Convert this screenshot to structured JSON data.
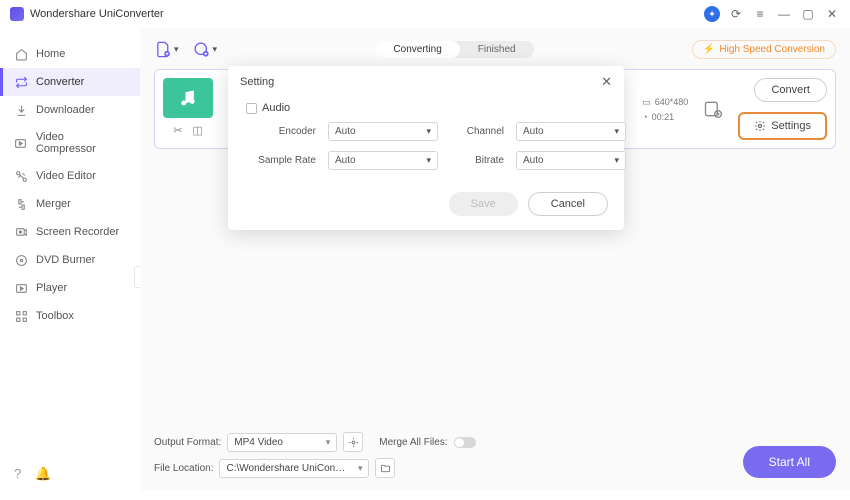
{
  "app_title": "Wondershare UniConverter",
  "sidebar": {
    "items": [
      {
        "label": "Home"
      },
      {
        "label": "Converter"
      },
      {
        "label": "Downloader"
      },
      {
        "label": "Video Compressor"
      },
      {
        "label": "Video Editor"
      },
      {
        "label": "Merger"
      },
      {
        "label": "Screen Recorder"
      },
      {
        "label": "DVD Burner"
      },
      {
        "label": "Player"
      },
      {
        "label": "Toolbox"
      }
    ]
  },
  "tabs": {
    "converting": "Converting",
    "finished": "Finished"
  },
  "speed_label": "High Speed Conversion",
  "file": {
    "resolution": "640*480",
    "duration": "00:21",
    "convert": "Convert",
    "settings": "Settings"
  },
  "modal": {
    "title": "Setting",
    "section": "Audio",
    "encoder_label": "Encoder",
    "encoder_value": "Auto",
    "channel_label": "Channel",
    "channel_value": "Auto",
    "sample_label": "Sample Rate",
    "sample_value": "Auto",
    "bitrate_label": "Bitrate",
    "bitrate_value": "Auto",
    "save": "Save",
    "cancel": "Cancel"
  },
  "bottom": {
    "output_format_label": "Output Format:",
    "output_format_value": "MP4 Video",
    "file_location_label": "File Location:",
    "file_location_value": "C:\\Wondershare UniConverter",
    "merge_label": "Merge All Files:",
    "start_all": "Start All"
  }
}
